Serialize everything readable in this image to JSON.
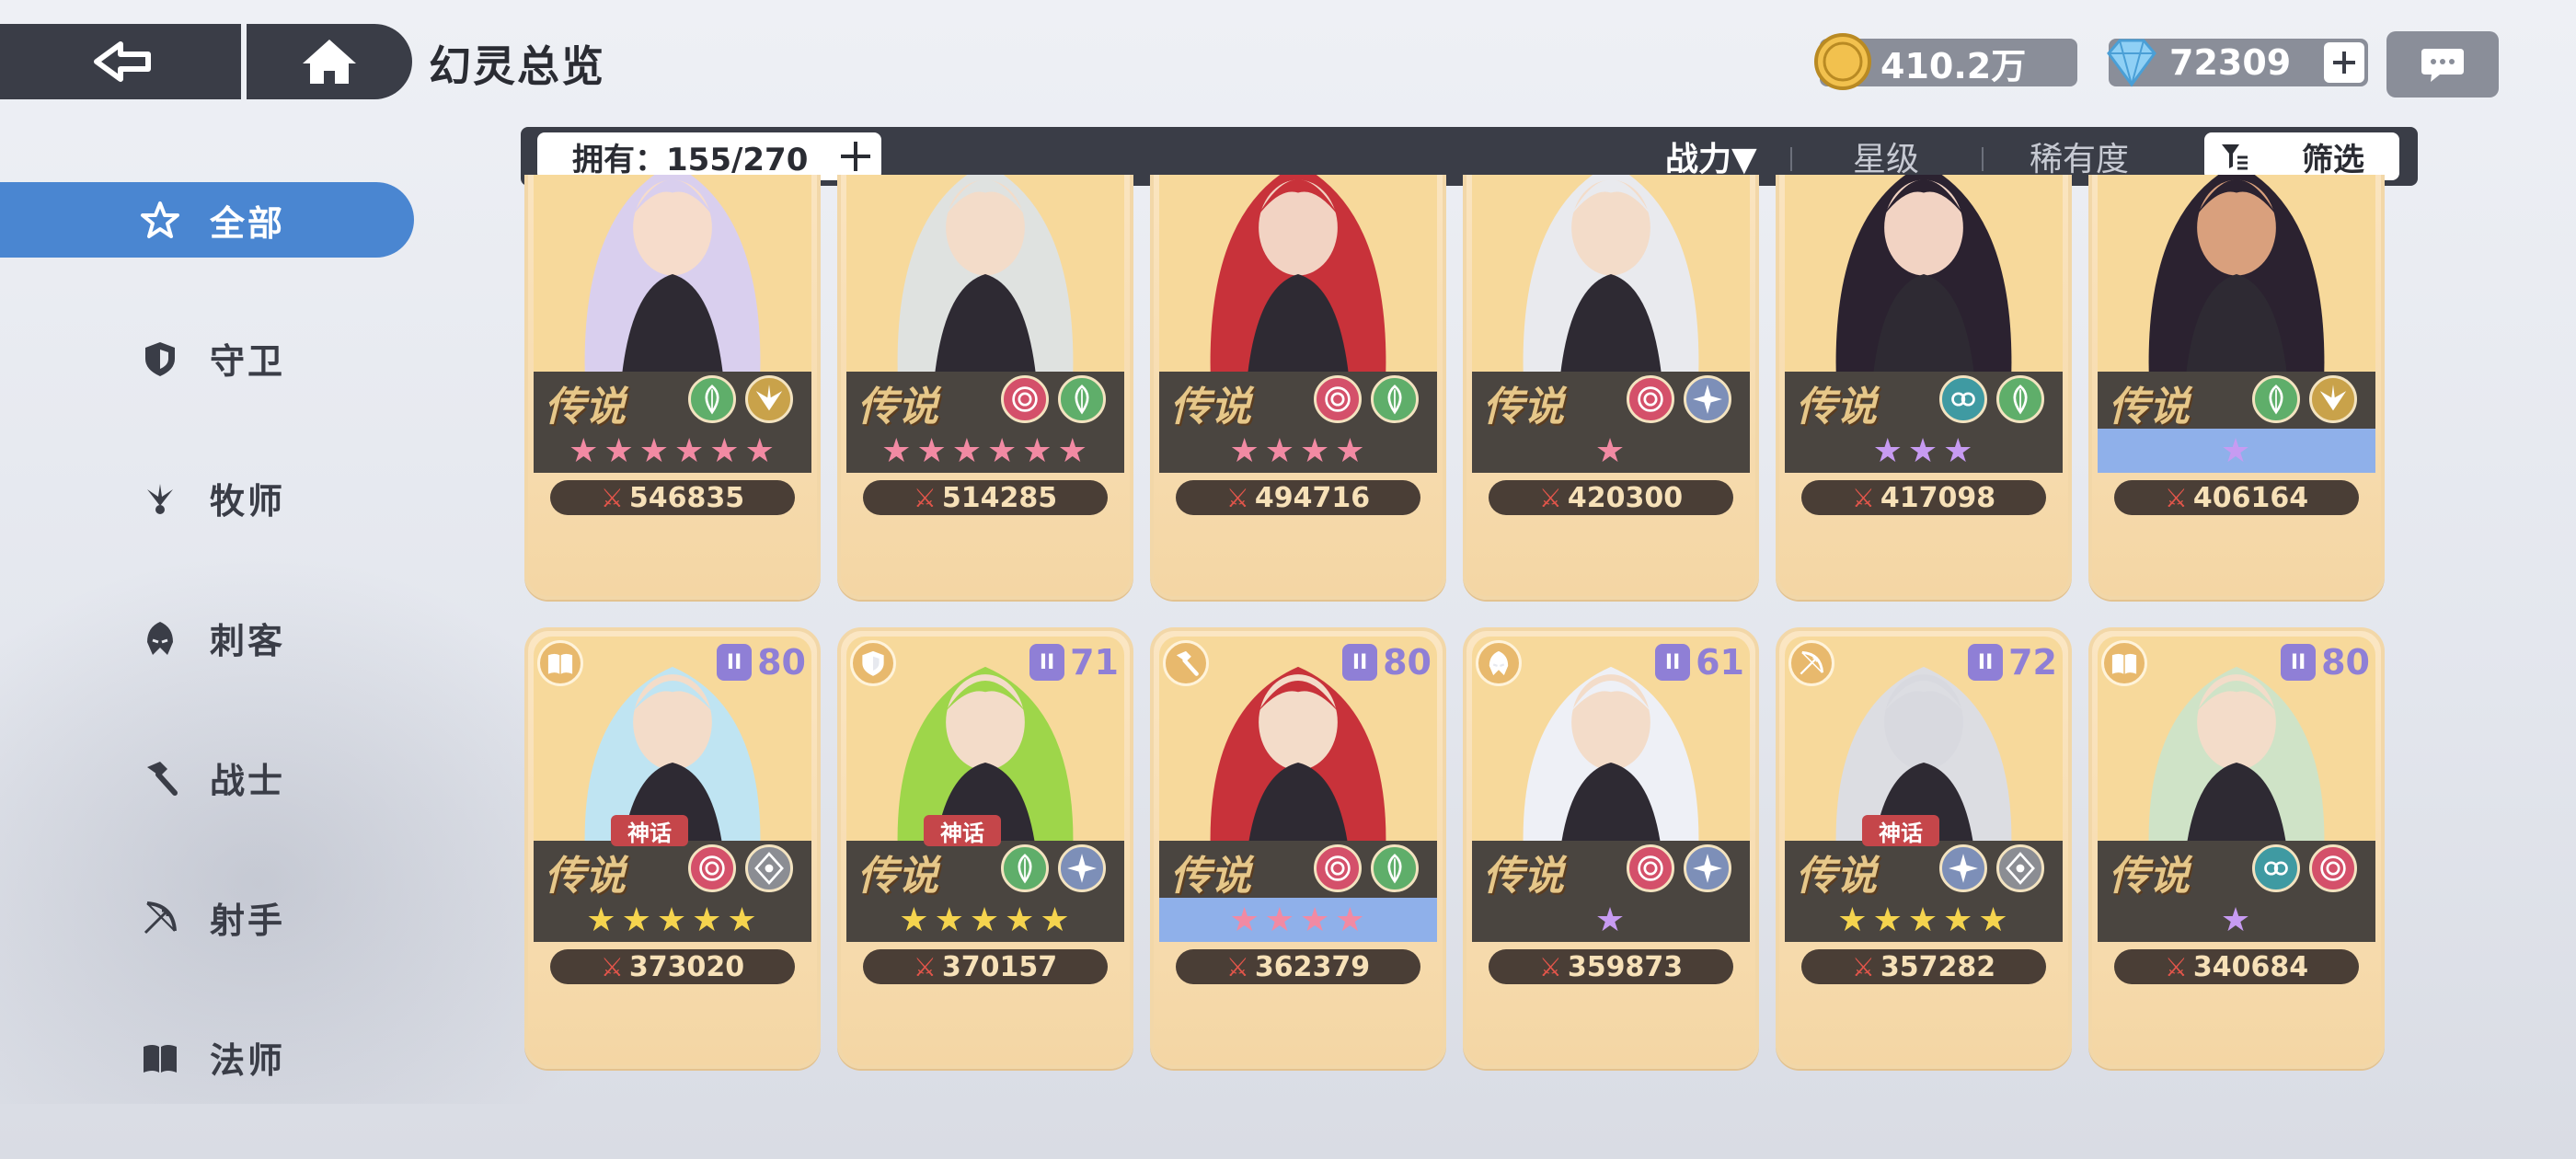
{
  "header": {
    "title": "幻灵总览",
    "gold": "410.2万",
    "gems": "72309"
  },
  "filterbar": {
    "owned": "拥有：155/270",
    "sort_power": "战力▼",
    "sort_star": "星级",
    "sort_rarity": "稀有度",
    "filter": "筛选"
  },
  "sidebar": [
    {
      "label": "全部",
      "icon": "all-star-icon",
      "active": true
    },
    {
      "label": "守卫",
      "icon": "shield-icon"
    },
    {
      "label": "牧师",
      "icon": "priest-icon"
    },
    {
      "label": "刺客",
      "icon": "assassin-icon"
    },
    {
      "label": "战士",
      "icon": "hammer-icon"
    },
    {
      "label": "射手",
      "icon": "bow-icon"
    },
    {
      "label": "法师",
      "icon": "book-icon"
    }
  ],
  "colors": {
    "accent": "#4a86d1",
    "dark_bar": "#3a3d47",
    "card_bg": "#f4d6a4",
    "power_text": "#f7e1b8"
  },
  "cards": [
    {
      "rank": "传说",
      "power": "546835",
      "stars": 6,
      "star_color": "pink",
      "strip": "dark",
      "elements": [
        "leaf",
        "wing"
      ],
      "hair": "#d9cfee",
      "skin": "#f6dccb"
    },
    {
      "rank": "传说",
      "power": "514285",
      "stars": 6,
      "star_color": "pink",
      "strip": "dark",
      "elements": [
        "swirl",
        "leaf"
      ],
      "hair": "#dfe2e0",
      "skin": "#f3dcc9"
    },
    {
      "rank": "传说",
      "power": "494716",
      "stars": 4,
      "star_color": "pink",
      "strip": "dark",
      "elements": [
        "swirl",
        "leaf"
      ],
      "hair": "#c8323a",
      "skin": "#f2d3c3"
    },
    {
      "rank": "传说",
      "power": "420300",
      "stars": 1,
      "star_color": "pink",
      "strip": "dark",
      "elements": [
        "swirl",
        "star"
      ],
      "hair": "#e9eaee",
      "skin": "#f3dcc9"
    },
    {
      "rank": "传说",
      "power": "417098",
      "stars": 3,
      "star_color": "purple",
      "strip": "dark",
      "elements": [
        "ring",
        "leaf"
      ],
      "hair": "#2b2230",
      "skin": "#f2d3c3"
    },
    {
      "rank": "传说",
      "power": "406164",
      "stars": 1,
      "star_color": "purple",
      "strip": "blue",
      "elements": [
        "leaf",
        "wing"
      ],
      "hair": "#2b2230",
      "skin": "#d9a07d"
    },
    {
      "rank": "传说",
      "power": "373020",
      "stars": 5,
      "star_color": "gold",
      "strip": "dark",
      "elements": [
        "swirl",
        "gem"
      ],
      "myth": "神话",
      "hair": "#bfe4f2",
      "skin": "#f3dcc9",
      "level": "80",
      "class": "book-icon"
    },
    {
      "rank": "传说",
      "power": "370157",
      "stars": 5,
      "star_color": "gold",
      "strip": "dark",
      "elements": [
        "leaf",
        "star"
      ],
      "myth": "神话",
      "hair": "#9ed64a",
      "skin": "#f3dcc9",
      "level": "71",
      "class": "shield-icon"
    },
    {
      "rank": "传说",
      "power": "362379",
      "stars": 4,
      "star_color": "pink",
      "strip": "blue",
      "elements": [
        "swirl",
        "leaf"
      ],
      "hair": "#c8323a",
      "skin": "#f3dcc9",
      "level": "80",
      "class": "hammer-icon"
    },
    {
      "rank": "传说",
      "power": "359873",
      "stars": 1,
      "star_color": "purple",
      "strip": "dark",
      "elements": [
        "swirl",
        "star"
      ],
      "hair": "#eef0f6",
      "skin": "#f3dcc9",
      "level": "61",
      "class": "assassin-icon"
    },
    {
      "rank": "传说",
      "power": "357282",
      "stars": 5,
      "star_color": "gold",
      "strip": "dark",
      "elements": [
        "star",
        "gem"
      ],
      "myth": "神话",
      "hair": "#dcdde2",
      "skin": "#d8d9df",
      "level": "72",
      "class": "bow-icon"
    },
    {
      "rank": "传说",
      "power": "340684",
      "stars": 1,
      "star_color": "purple",
      "strip": "dark",
      "elements": [
        "ring",
        "swirl"
      ],
      "hair": "#cfe3c7",
      "skin": "#f3dcc9",
      "level": "80",
      "class": "book-icon"
    }
  ]
}
